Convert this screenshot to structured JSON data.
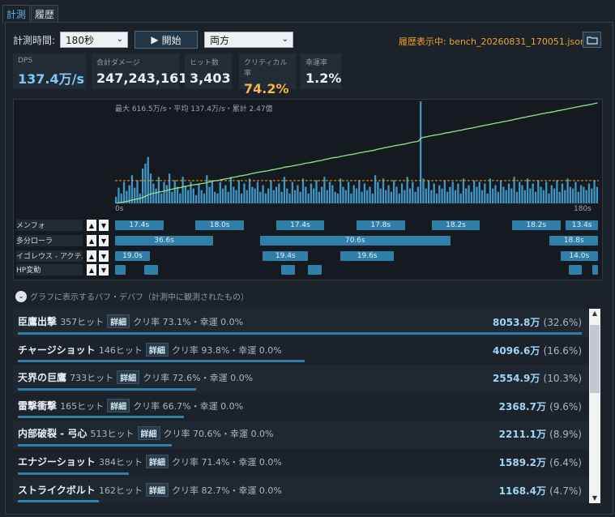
{
  "tabs": [
    {
      "label": "計測"
    },
    {
      "label": "履歴"
    }
  ],
  "controls": {
    "duration_label": "計測時間:",
    "duration_value": "180秒",
    "start_label": "開始",
    "mode_value": "両方",
    "history_label": "履歴表示中: bench_20260831_170051.json"
  },
  "stats": [
    {
      "label": "DPS",
      "value": "137.4万/s",
      "color": "#7fc8f8"
    },
    {
      "label": "合計ダメージ",
      "value": "247,243,161",
      "color": "#e8eef2"
    },
    {
      "label": "ヒット数",
      "value": "3,403",
      "color": "#e8eef2"
    },
    {
      "label": "クリティカル率",
      "value": "74.2%",
      "color": "#f5b547"
    },
    {
      "label": "幸運率",
      "value": "1.2%",
      "color": "#e8eef2"
    }
  ],
  "chart_caption": "最大 616.5万/s・平均 137.4万/s・累計 2.47億",
  "chart_data": {
    "type": "bar",
    "description_series": [
      "DPS per second",
      "cumulative damage"
    ],
    "x_start_label": "0s",
    "x_end_label": "180s",
    "max_dps": 616.5,
    "avg_dps": 137.4,
    "x": [
      0,
      180
    ],
    "values": [
      40,
      95,
      60,
      130,
      75,
      110,
      170,
      95,
      140,
      60,
      210,
      240,
      280,
      180,
      120,
      90,
      160,
      60,
      130,
      110,
      180,
      70,
      140,
      100,
      60,
      160,
      100,
      80,
      130,
      90,
      50,
      120,
      80,
      60,
      170,
      100,
      140,
      70,
      60,
      130,
      90,
      110,
      70,
      160,
      100,
      80,
      140,
      60,
      120,
      80,
      150,
      100,
      90,
      130,
      70,
      110,
      60,
      90,
      140,
      80,
      100,
      120,
      70,
      160,
      90,
      60,
      130,
      80,
      110,
      70,
      150,
      100,
      60,
      120,
      90,
      140,
      70,
      100,
      160,
      80,
      130,
      110,
      70,
      60,
      150,
      100,
      80,
      130,
      60,
      110,
      90,
      140,
      70,
      120,
      80,
      100,
      60,
      170,
      130,
      90,
      150,
      80,
      110,
      70,
      140,
      100,
      60,
      120,
      80,
      160,
      90,
      130,
      70,
      100,
      616,
      150,
      90,
      140,
      80,
      120,
      60,
      110,
      90,
      140,
      70,
      100,
      130,
      80,
      120,
      60,
      150,
      90,
      110,
      70,
      140,
      100,
      130,
      80,
      120,
      60,
      150,
      90,
      110,
      70,
      140,
      100,
      80,
      120,
      90,
      160,
      70,
      130,
      110,
      80,
      150,
      90,
      120,
      70,
      140,
      100,
      80,
      130,
      60,
      110,
      90,
      140,
      70,
      120,
      80,
      150,
      100,
      90,
      130,
      70,
      110,
      100,
      80,
      120,
      90,
      140,
      100
    ]
  },
  "buffs": [
    {
      "name": "メンフォ",
      "segments": [
        {
          "from": 0,
          "to": 18,
          "label": "17.4s"
        },
        {
          "from": 30,
          "to": 48,
          "label": "18.0s"
        },
        {
          "from": 60,
          "to": 78,
          "label": "17.4s"
        },
        {
          "from": 90,
          "to": 108,
          "label": "17.8s"
        },
        {
          "from": 118,
          "to": 136,
          "label": "18.2s"
        },
        {
          "from": 148,
          "to": 166,
          "label": "18.2s"
        },
        {
          "from": 168,
          "to": 180,
          "label": "13.4s"
        }
      ]
    },
    {
      "name": "多分ローラ",
      "segments": [
        {
          "from": 0,
          "to": 36.6,
          "label": "36.6s"
        },
        {
          "from": 54,
          "to": 125,
          "label": "70.6s"
        },
        {
          "from": 162,
          "to": 180,
          "label": "18.8s"
        }
      ]
    },
    {
      "name": "イゴレウス - アクテ...",
      "segments": [
        {
          "from": 0,
          "to": 13,
          "label": "19.0s"
        },
        {
          "from": 55,
          "to": 72,
          "label": "19.4s"
        },
        {
          "from": 84,
          "to": 104,
          "label": "19.6s"
        },
        {
          "from": 166,
          "to": 180,
          "label": "14.0s"
        }
      ]
    },
    {
      "name": "HP変動",
      "segments": [
        {
          "from": 0,
          "to": 4,
          "label": ""
        },
        {
          "from": 11,
          "to": 16,
          "label": ""
        },
        {
          "from": 62,
          "to": 67,
          "label": ""
        },
        {
          "from": 72,
          "to": 77,
          "label": ""
        },
        {
          "from": 169,
          "to": 174,
          "label": ""
        },
        {
          "from": 178,
          "to": 180,
          "label": ""
        }
      ]
    }
  ],
  "toggle_label": "グラフに表示するバフ・デバフ（計測中に観測されたもの）",
  "skills": [
    {
      "name": "臣鷹出撃",
      "hits": "357ヒット",
      "detail": "詳細",
      "meta": "クリ率 73.1%・幸運 0.0%",
      "damage": "8053.8万",
      "percent": "(32.6%)",
      "share": 0.326
    },
    {
      "name": "チャージショット",
      "hits": "146ヒット",
      "detail": "詳細",
      "meta": "クリ率 93.8%・幸運 0.0%",
      "damage": "4096.6万",
      "percent": "(16.6%)",
      "share": 0.166
    },
    {
      "name": "天界の巨鷹",
      "hits": "733ヒット",
      "detail": "詳細",
      "meta": "クリ率 72.6%・幸運 0.0%",
      "damage": "2554.9万",
      "percent": "(10.3%)",
      "share": 0.103
    },
    {
      "name": "雷撃衝撃",
      "hits": "165ヒット",
      "detail": "詳細",
      "meta": "クリ率 66.7%・幸運 0.0%",
      "damage": "2368.7万",
      "percent": "(9.6%)",
      "share": 0.096
    },
    {
      "name": "内部破裂 - 弓心",
      "hits": "513ヒット",
      "detail": "詳細",
      "meta": "クリ率 70.6%・幸運 0.0%",
      "damage": "2211.1万",
      "percent": "(8.9%)",
      "share": 0.089
    },
    {
      "name": "エナジーショット",
      "hits": "384ヒット",
      "detail": "詳細",
      "meta": "クリ率 71.4%・幸運 0.0%",
      "damage": "1589.2万",
      "percent": "(6.4%)",
      "share": 0.064
    },
    {
      "name": "ストライクボルト",
      "hits": "162ヒット",
      "detail": "詳細",
      "meta": "クリ率 82.7%・幸運 0.0%",
      "damage": "1168.4万",
      "percent": "(4.7%)",
      "share": 0.047
    }
  ]
}
